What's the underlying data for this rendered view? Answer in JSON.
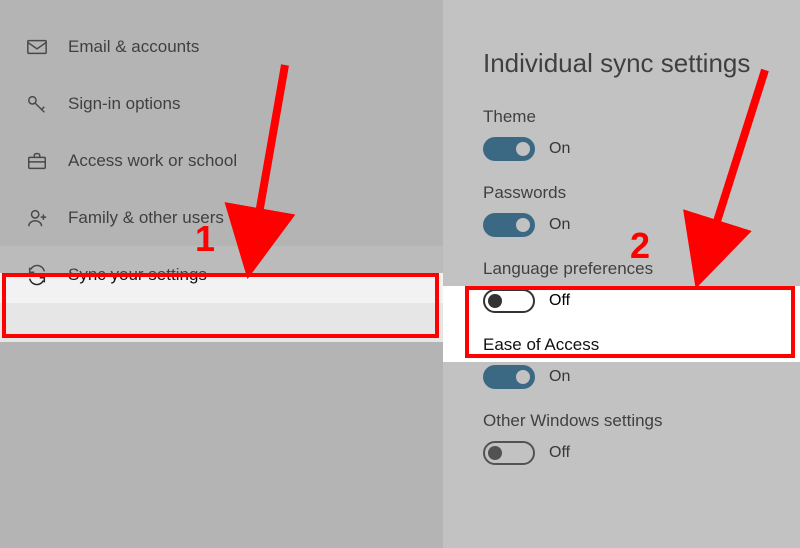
{
  "sidebar": {
    "items": [
      {
        "icon": "mail-icon",
        "label": "Email & accounts"
      },
      {
        "icon": "key-icon",
        "label": "Sign-in options"
      },
      {
        "icon": "briefcase-icon",
        "label": "Access work or school"
      },
      {
        "icon": "person-add-icon",
        "label": "Family & other users"
      },
      {
        "icon": "sync-icon",
        "label": "Sync your settings",
        "selected": true
      }
    ]
  },
  "panel": {
    "heading": "Individual sync settings",
    "settings": [
      {
        "label": "Theme",
        "on": true,
        "state": "On"
      },
      {
        "label": "Passwords",
        "on": true,
        "state": "On"
      },
      {
        "label": "Language preferences",
        "on": false,
        "state": "Off"
      },
      {
        "label": "Ease of Access",
        "on": true,
        "state": "On"
      },
      {
        "label": "Other Windows settings",
        "on": false,
        "state": "Off"
      }
    ]
  },
  "annotations": [
    {
      "text": "1",
      "target": "sidebar-item-sync-settings"
    },
    {
      "text": "2",
      "target": "setting-language-preferences"
    }
  ],
  "colors": {
    "accent": "#0a5e8f",
    "annotation": "#ff0000"
  }
}
